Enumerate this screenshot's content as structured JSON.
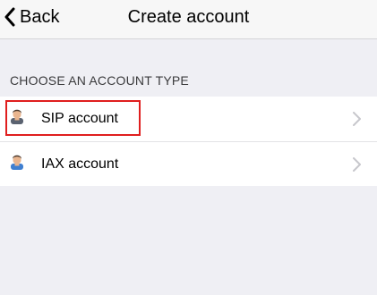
{
  "navbar": {
    "back_label": "Back",
    "back_icon": "chevron-left-icon",
    "title": "Create account"
  },
  "section": {
    "header": "CHOOSE AN ACCOUNT TYPE"
  },
  "accounts": [
    {
      "label": "SIP account",
      "icon": "user-avatar-icon",
      "highlighted": true
    },
    {
      "label": "IAX account",
      "icon": "user-avatar-icon",
      "highlighted": false
    }
  ],
  "colors": {
    "highlight": "#e01e1e",
    "navbar_bg": "#f7f7f7",
    "page_bg": "#efeff4",
    "chevron": "#c7c7cc"
  }
}
